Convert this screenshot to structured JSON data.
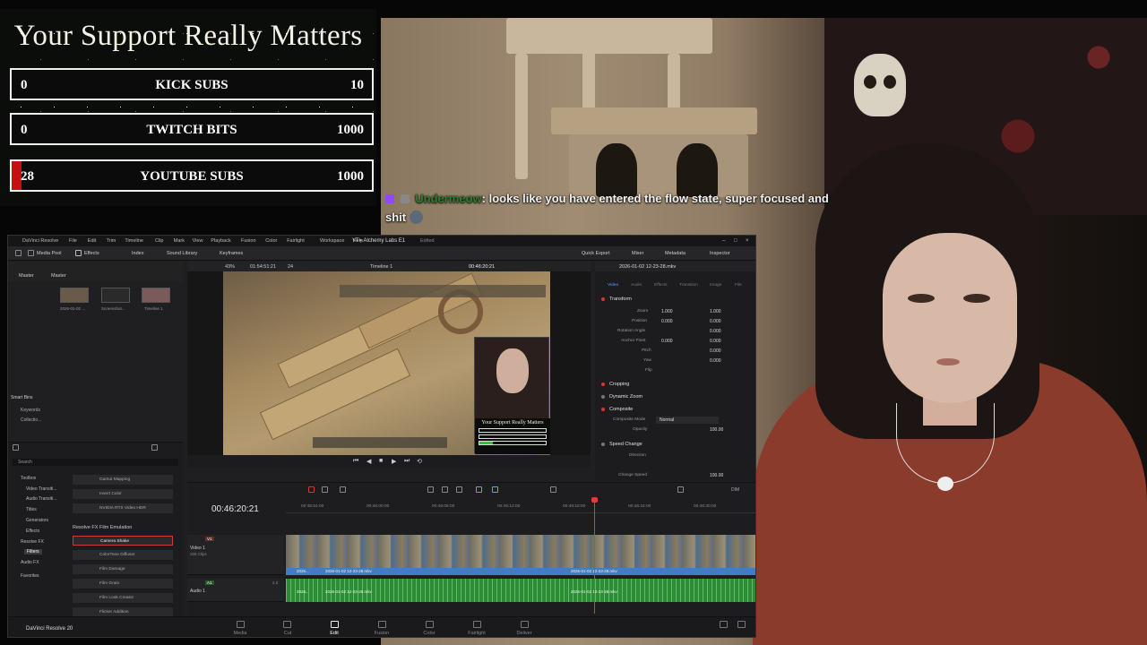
{
  "goals": {
    "title": "Your Support Really Matters",
    "items": [
      {
        "current": "0",
        "label": "KICK SUBS",
        "target": "10",
        "progress": 0.0
      },
      {
        "current": "0",
        "label": "TWITCH BITS",
        "target": "1000",
        "progress": 0.0
      },
      {
        "current": "28",
        "label": "YOUTUBE SUBS",
        "target": "1000",
        "progress": 0.028
      }
    ]
  },
  "chat": {
    "username": "Undermeow",
    "message": ": looks like you have entered the flow state, super focused and shit"
  },
  "resolve": {
    "app_title": "DaVinci Resolve",
    "menu": [
      "File",
      "Edit",
      "Trim",
      "Timeline",
      "Clip",
      "Mark",
      "View",
      "Playback",
      "Fusion",
      "Color",
      "Fairlight",
      "Workspace",
      "Help"
    ],
    "project_title": "YT= Alchemy Labs E1",
    "edited": "Edited",
    "toolbar": {
      "media_pool": "Media Pool",
      "effects": "Effects",
      "index": "Index",
      "sound_library": "Sound Library",
      "keyframes": "Keyframes",
      "quick_export": "Quick Export",
      "mixer": "Mixer",
      "metadata": "Metadata",
      "inspector": "Inspector"
    },
    "media_pool": {
      "tab_master": "Master",
      "folder": "Master",
      "clips": [
        "2026-01-02 ...",
        "Screenshot...",
        "Timeline 1"
      ],
      "smart_bins": "Smart Bins",
      "keywords": "Keywords",
      "collections": "Collectio..."
    },
    "effects": {
      "search": "Search",
      "categories": [
        "Toolbox",
        "Video Transiti...",
        "Audio Transiti...",
        "Titles",
        "Generators",
        "Effects",
        "Resolve FX",
        "Filters",
        "Audio FX",
        "Favorites"
      ],
      "items_top": [
        "Gamut Mapping",
        "Invert Color",
        "NVIDIA RTX Video HDR"
      ],
      "section": "Resolve FX Film Emulation",
      "items": [
        "Camera Shake",
        "ColorTone Diffuser",
        "Film Damage",
        "Film Grain",
        "Film Look Creator",
        "Flicker Addition"
      ],
      "selected": "Camera Shake"
    },
    "viewer": {
      "zoom": "43%",
      "timecode_src": "01:54:51:21",
      "fps": "24",
      "timeline_name": "Timeline 1",
      "timecode": "00:46:20:21",
      "pip_goal_title": "Your Support Really Matters"
    },
    "inspector": {
      "clip_name": "2026-01-02 12-23-28.mkv",
      "tabs": [
        "Video",
        "Audio",
        "Effects",
        "Transition",
        "Image",
        "File"
      ],
      "transform": "Transform",
      "rows": [
        {
          "label": "Zoom",
          "x": "1.000",
          "y": "1.000"
        },
        {
          "label": "Position",
          "x": "0.000",
          "y": "0.000"
        },
        {
          "label": "Rotation Angle",
          "x": "",
          "y": "0.000"
        },
        {
          "label": "Anchor Point",
          "x": "0.000",
          "y": "0.000"
        },
        {
          "label": "Pitch",
          "x": "",
          "y": "0.000"
        },
        {
          "label": "Yaw",
          "x": "",
          "y": "0.000"
        },
        {
          "label": "Flip",
          "x": "",
          "y": ""
        }
      ],
      "cropping": "Cropping",
      "dynamic_zoom": "Dynamic Zoom",
      "composite": "Composite",
      "composite_mode_label": "Composite Mode",
      "composite_mode": "Normal",
      "opacity_label": "Opacity",
      "opacity": "100.00",
      "speed_change": "Speed Change",
      "direction_label": "Direction",
      "change_speed_label": "Change Speed",
      "change_speed": "100.00"
    },
    "timeline": {
      "timecode": "00:46:20:21",
      "ruler": [
        "00:45:54:00",
        "00:46:00:00",
        "00:46:06:00",
        "00:46:12:00",
        "00:46:18:00",
        "00:46:24:00",
        "00:46:30:00"
      ],
      "video_track": {
        "id": "V1",
        "name": "Video 1",
        "info": "269 Clips"
      },
      "audio_track": {
        "id": "A1",
        "name": "Audio 1",
        "info": "2.0"
      },
      "clip_labels": [
        "2026...",
        "2026-01-02 12-23-28.mkv",
        "2026-01-02 12-23-28.mkv"
      ],
      "audio_clip_labels": [
        "2026...",
        "2026-01-02 12-23-28.mkv",
        "2026-01-02 12-23-28.mkv"
      ],
      "audio_meter": "DIM"
    },
    "pages": [
      "Media",
      "Cut",
      "Edit",
      "Fusion",
      "Color",
      "Fairlight",
      "Deliver"
    ],
    "active_page": "Edit",
    "brand": "DaVinci Resolve 20"
  }
}
